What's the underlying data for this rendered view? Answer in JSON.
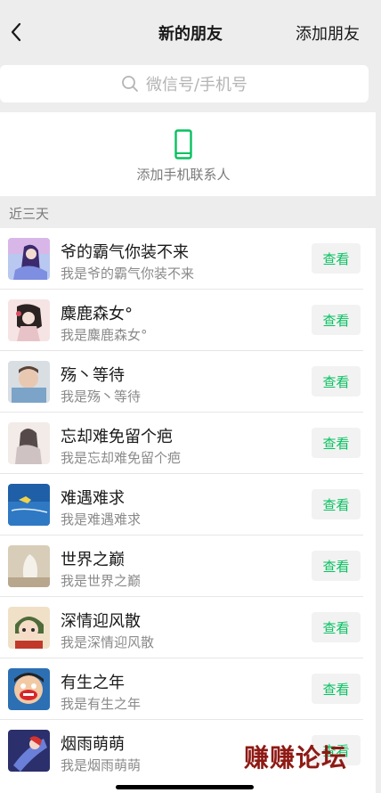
{
  "navbar": {
    "title": "新的朋友",
    "action": "添加朋友"
  },
  "search": {
    "placeholder": "微信号/手机号"
  },
  "contacts_entry": {
    "label": "添加手机联系人"
  },
  "section": {
    "label": "近三天"
  },
  "requests": [
    {
      "name": "爷的霸气你装不来",
      "message": "我是爷的霸气你装不来",
      "button": "查看"
    },
    {
      "name": "麋鹿森女°",
      "message": "我是麋鹿森女°",
      "button": "查看"
    },
    {
      "name": "殇丶等待",
      "message": "我是殇丶等待",
      "button": "查看"
    },
    {
      "name": "忘却难免留个疤",
      "message": "我是忘却难免留个疤",
      "button": "查看"
    },
    {
      "name": "难遇难求",
      "message": "我是难遇难求",
      "button": "查看"
    },
    {
      "name": "世界之巅",
      "message": "我是世界之巅",
      "button": "查看"
    },
    {
      "name": "深情迎风散",
      "message": "我是深情迎风散",
      "button": "查看"
    },
    {
      "name": "有生之年",
      "message": "我是有生之年",
      "button": "查看"
    },
    {
      "name": "烟雨萌萌",
      "message": "我是烟雨萌萌",
      "button": "查看"
    }
  ],
  "watermark": "赚赚论坛",
  "colors": {
    "accent": "#07c160",
    "background": "#ededed",
    "button_bg": "#f2f2f2"
  },
  "icons": {
    "back": "chevron-left-icon",
    "search": "search-icon",
    "contacts": "phone-icon"
  }
}
